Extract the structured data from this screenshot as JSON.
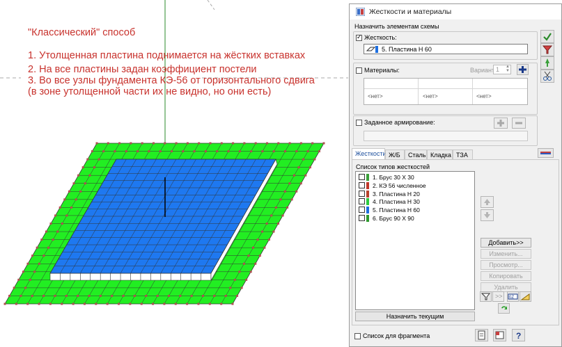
{
  "annotation": {
    "title": "\"Классический\" способ",
    "lines": [
      "1. Утолщенная пластина поднимается на жёстких вставках",
      "2. На все пластины задан коэффициент постели",
      "3. Во все узлы фундамента КЭ-56 от горизонтального сдвига",
      "(в зоне утолщенной части их не видно, но они есть)"
    ]
  },
  "colors": {
    "annotation_text": "#c8322d",
    "outer_plate": "#22ee22",
    "inner_plate": "#1e78f0",
    "grid_lines": "#333333",
    "node_marks": "#b05050"
  },
  "dialog": {
    "title": "Жесткости и материалы",
    "assign_label": "Назначить элементам схемы",
    "stiffness": {
      "label": "Жесткость:",
      "checked": true,
      "value": "5. Пластина  Н 60"
    },
    "materials": {
      "label": "Материалы:",
      "checked": false,
      "variant_label": "Вариант",
      "variant_value": "1",
      "cells": [
        "<нет>",
        "<нет>",
        "<нет>"
      ]
    },
    "reinforcement": {
      "label": "Заданное армирование:",
      "checked": false
    },
    "tabs": [
      "Жесткости",
      "Ж/Б",
      "Сталь",
      "Кладка",
      "ТЗА"
    ],
    "active_tab": "Жесткости",
    "list_label": "Список типов жесткостей",
    "list_items": [
      {
        "text": "1. Брус 30 Х 30",
        "color": "#3aa03a"
      },
      {
        "text": "2. КЭ 56 численное",
        "color": "#c0392b"
      },
      {
        "text": "3. Пластина  Н 20",
        "color": "#b8422c"
      },
      {
        "text": "4. Пластина  Н 30",
        "color": "#2ecc40"
      },
      {
        "text": "5. Пластина  Н 60",
        "color": "#1e6fe0"
      },
      {
        "text": "6. Брус 90 Х 90",
        "color": "#2e9a2e"
      }
    ],
    "buttons": {
      "add": "Добавить>>",
      "edit": "Изменить...",
      "view": "Просмотр...",
      "copy": "Копировать",
      "delete": "Удалить",
      "set_current": "Назначить текущим"
    },
    "fragment_list": {
      "label": "Список для фрагмента",
      "checked": false
    }
  }
}
